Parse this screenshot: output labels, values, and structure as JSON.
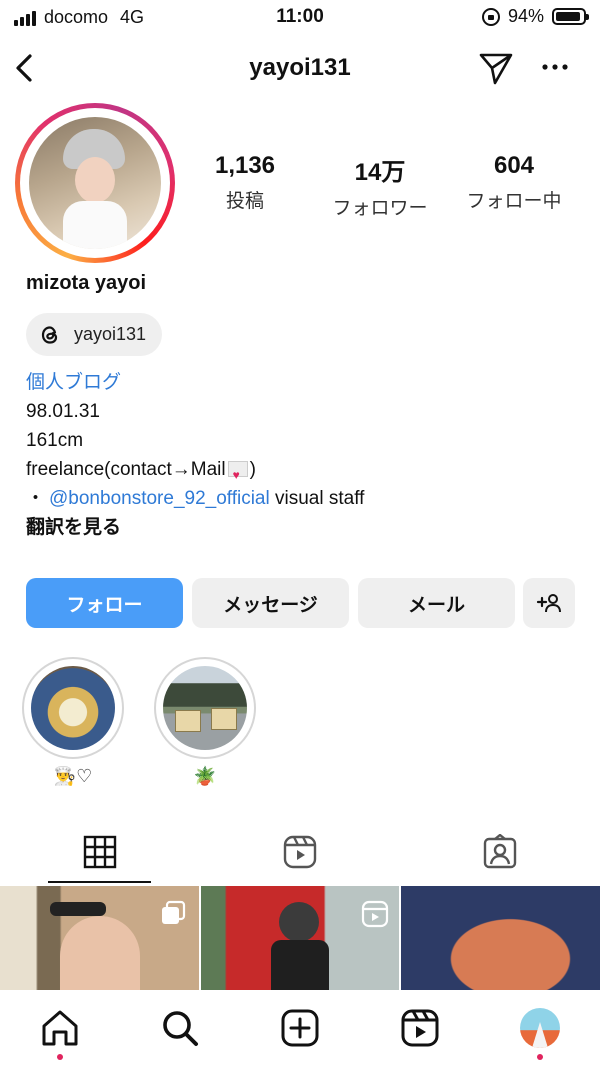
{
  "status_bar": {
    "carrier": "docomo",
    "network": "4G",
    "time": "11:00",
    "battery": "94%",
    "battery_level": 0.94
  },
  "header": {
    "username": "yayoi131"
  },
  "profile": {
    "stats": [
      {
        "value": "1,136",
        "label": "投稿"
      },
      {
        "value": "14万",
        "label": "フォロワー"
      },
      {
        "value": "604",
        "label": "フォロー中"
      }
    ],
    "display_name": "mizota yayoi",
    "threads_handle": "yayoi131",
    "bio": {
      "link_text": "個人ブログ",
      "line1": "98.01.31",
      "line2": "161cm",
      "line3_pre": "freelance(contact→Mail",
      "line3_post": ")",
      "line4_bullet": "・",
      "line4_mention": "@bonbonstore_92_official",
      "line4_post": " visual staff",
      "translate": "翻訳を見る"
    }
  },
  "actions": {
    "follow": "フォロー",
    "message": "メッセージ",
    "email": "メール"
  },
  "highlights": [
    {
      "label": "👨‍🍳♡"
    },
    {
      "label": "🪴"
    }
  ],
  "tabs": [
    {
      "icon": "grid-icon",
      "active": true
    },
    {
      "icon": "reels-icon",
      "active": false
    },
    {
      "icon": "tagged-icon",
      "active": false
    }
  ],
  "bottom_nav": [
    {
      "icon": "home-icon",
      "notification": true
    },
    {
      "icon": "search-icon",
      "notification": false
    },
    {
      "icon": "create-icon",
      "notification": false
    },
    {
      "icon": "reels-icon",
      "notification": false
    },
    {
      "icon": "profile-avatar",
      "notification": true
    }
  ],
  "colors": {
    "follow_button": "#4a9df8",
    "link": "#2f7ad6",
    "notification_dot": "#e0245e"
  }
}
